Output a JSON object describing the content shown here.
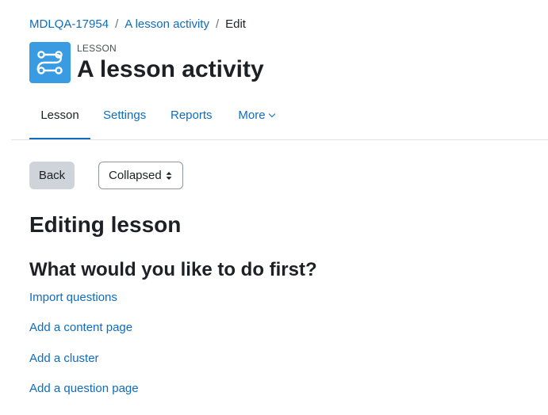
{
  "breadcrumb": {
    "items": [
      "MDLQA-17954",
      "A lesson activity",
      "Edit"
    ],
    "separator": "/"
  },
  "header": {
    "icon": "lesson-icon",
    "activity_type": "LESSON",
    "title": "A lesson activity"
  },
  "nav": {
    "tabs": [
      {
        "label": "Lesson",
        "active": true
      },
      {
        "label": "Settings",
        "active": false
      },
      {
        "label": "Reports",
        "active": false
      },
      {
        "label": "More",
        "active": false
      }
    ]
  },
  "controls": {
    "back_label": "Back",
    "view_mode": "Collapsed"
  },
  "main": {
    "heading": "Editing lesson",
    "subheading": "What would you like to do first?",
    "actions": [
      "Import questions",
      "Add a content page",
      "Add a cluster",
      "Add a question page"
    ]
  },
  "colors": {
    "link": "#0f6cbf",
    "text": "#1d2125",
    "icon_bg": "#399be2",
    "button_bg": "#ced4da"
  }
}
